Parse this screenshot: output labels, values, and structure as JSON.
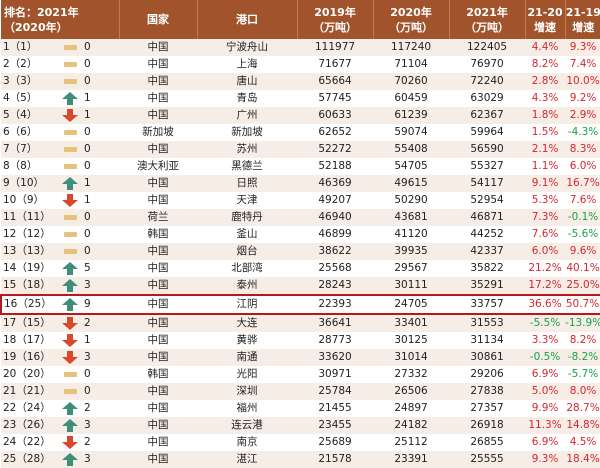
{
  "colors": {
    "header_bg": "#a1532c",
    "header_text": "#ffffff",
    "row_alt": "#f6ede6",
    "up_arrow": "#3e8e7a",
    "down_arrow": "#d9482b",
    "flat_bar": "#e7c27a",
    "positive_pct": "#d7262d",
    "negative_pct": "#16a24a",
    "highlight_border": "#b8171c"
  },
  "header": {
    "rank": "排名：2021年",
    "rank_sub": "（2020年）",
    "country": "国家",
    "port": "港口",
    "y2019": "2019年",
    "y2019_unit": "（万吨）",
    "y2020": "2020年",
    "y2020_unit": "（万吨）",
    "y2021": "2021年",
    "y2021_unit": "（万吨）",
    "g2120": "21-20",
    "g2120_sub": "增速",
    "g2119": "21-19",
    "g2119_sub": "增速"
  },
  "rows": [
    {
      "rank": "1（1）",
      "trend": "flat-bar-icon",
      "change": "0",
      "country": "中国",
      "port": "宁波舟山",
      "y2019": "111977",
      "y2020": "117240",
      "y2021": "122405",
      "g2120": "4.4%",
      "g2119": "9.3%"
    },
    {
      "rank": "2（2）",
      "trend": "flat-bar-icon",
      "change": "0",
      "country": "中国",
      "port": "上海",
      "y2019": "71677",
      "y2020": "71104",
      "y2021": "76970",
      "g2120": "8.2%",
      "g2119": "7.4%"
    },
    {
      "rank": "3（3）",
      "trend": "flat-bar-icon",
      "change": "0",
      "country": "中国",
      "port": "唐山",
      "y2019": "65664",
      "y2020": "70260",
      "y2021": "72240",
      "g2120": "2.8%",
      "g2119": "10.0%"
    },
    {
      "rank": "4（5）",
      "trend": "up-arrow-icon",
      "change": "1",
      "country": "中国",
      "port": "青岛",
      "y2019": "57745",
      "y2020": "60459",
      "y2021": "63029",
      "g2120": "4.3%",
      "g2119": "9.2%"
    },
    {
      "rank": "5（4）",
      "trend": "down-arrow-icon",
      "change": "1",
      "country": "中国",
      "port": "广州",
      "y2019": "60633",
      "y2020": "61239",
      "y2021": "62367",
      "g2120": "1.8%",
      "g2119": "2.9%"
    },
    {
      "rank": "6（6）",
      "trend": "flat-bar-icon",
      "change": "0",
      "country": "新加坡",
      "port": "新加坡",
      "y2019": "62652",
      "y2020": "59074",
      "y2021": "59964",
      "g2120": "1.5%",
      "g2119": "-4.3%"
    },
    {
      "rank": "7（7）",
      "trend": "flat-bar-icon",
      "change": "0",
      "country": "中国",
      "port": "苏州",
      "y2019": "52272",
      "y2020": "55408",
      "y2021": "56590",
      "g2120": "2.1%",
      "g2119": "8.3%"
    },
    {
      "rank": "8（8）",
      "trend": "flat-bar-icon",
      "change": "0",
      "country": "澳大利亚",
      "port": "黑德兰",
      "y2019": "52188",
      "y2020": "54705",
      "y2021": "55327",
      "g2120": "1.1%",
      "g2119": "6.0%"
    },
    {
      "rank": "9（10）",
      "trend": "up-arrow-icon",
      "change": "1",
      "country": "中国",
      "port": "日照",
      "y2019": "46369",
      "y2020": "49615",
      "y2021": "54117",
      "g2120": "9.1%",
      "g2119": "16.7%"
    },
    {
      "rank": "10（9）",
      "trend": "down-arrow-icon",
      "change": "1",
      "country": "中国",
      "port": "天津",
      "y2019": "49207",
      "y2020": "50290",
      "y2021": "52954",
      "g2120": "5.3%",
      "g2119": "7.6%"
    },
    {
      "rank": "11（11）",
      "trend": "flat-bar-icon",
      "change": "0",
      "country": "荷兰",
      "port": "鹿特丹",
      "y2019": "46940",
      "y2020": "43681",
      "y2021": "46871",
      "g2120": "7.3%",
      "g2119": "-0.1%"
    },
    {
      "rank": "12（12）",
      "trend": "flat-bar-icon",
      "change": "0",
      "country": "韩国",
      "port": "釜山",
      "y2019": "46899",
      "y2020": "41120",
      "y2021": "44252",
      "g2120": "7.6%",
      "g2119": "-5.6%"
    },
    {
      "rank": "13（13）",
      "trend": "flat-bar-icon",
      "change": "0",
      "country": "中国",
      "port": "烟台",
      "y2019": "38622",
      "y2020": "39935",
      "y2021": "42337",
      "g2120": "6.0%",
      "g2119": "9.6%"
    },
    {
      "rank": "14（19）",
      "trend": "up-arrow-icon",
      "change": "5",
      "country": "中国",
      "port": "北部湾",
      "y2019": "25568",
      "y2020": "29567",
      "y2021": "35822",
      "g2120": "21.2%",
      "g2119": "40.1%"
    },
    {
      "rank": "15（18）",
      "trend": "up-arrow-icon",
      "change": "3",
      "country": "中国",
      "port": "泰州",
      "y2019": "28243",
      "y2020": "30111",
      "y2021": "35291",
      "g2120": "17.2%",
      "g2119": "25.0%"
    },
    {
      "rank": "16（25）",
      "trend": "up-arrow-icon",
      "change": "9",
      "country": "中国",
      "port": "江阴",
      "y2019": "22393",
      "y2020": "24705",
      "y2021": "33757",
      "g2120": "36.6%",
      "g2119": "50.7%",
      "highlight": true
    },
    {
      "rank": "17（15）",
      "trend": "down-arrow-icon",
      "change": "2",
      "country": "中国",
      "port": "大连",
      "y2019": "36641",
      "y2020": "33401",
      "y2021": "31553",
      "g2120": "-5.5%",
      "g2119": "-13.9%"
    },
    {
      "rank": "18（17）",
      "trend": "down-arrow-icon",
      "change": "1",
      "country": "中国",
      "port": "黄骅",
      "y2019": "28773",
      "y2020": "30125",
      "y2021": "31134",
      "g2120": "3.3%",
      "g2119": "8.2%"
    },
    {
      "rank": "19（16）",
      "trend": "down-arrow-icon",
      "change": "3",
      "country": "中国",
      "port": "南通",
      "y2019": "33620",
      "y2020": "31014",
      "y2021": "30861",
      "g2120": "-0.5%",
      "g2119": "-8.2%"
    },
    {
      "rank": "20（20）",
      "trend": "flat-bar-icon",
      "change": "0",
      "country": "韩国",
      "port": "光阳",
      "y2019": "30971",
      "y2020": "27332",
      "y2021": "29206",
      "g2120": "6.9%",
      "g2119": "-5.7%"
    },
    {
      "rank": "21（21）",
      "trend": "flat-bar-icon",
      "change": "0",
      "country": "中国",
      "port": "深圳",
      "y2019": "25784",
      "y2020": "26506",
      "y2021": "27838",
      "g2120": "5.0%",
      "g2119": "8.0%"
    },
    {
      "rank": "22（24）",
      "trend": "up-arrow-icon",
      "change": "2",
      "country": "中国",
      "port": "福州",
      "y2019": "21455",
      "y2020": "24897",
      "y2021": "27357",
      "g2120": "9.9%",
      "g2119": "28.7%"
    },
    {
      "rank": "23（26）",
      "trend": "up-arrow-icon",
      "change": "3",
      "country": "中国",
      "port": "连云港",
      "y2019": "23455",
      "y2020": "24182",
      "y2021": "26918",
      "g2120": "11.3%",
      "g2119": "14.8%"
    },
    {
      "rank": "24（22）",
      "trend": "down-arrow-icon",
      "change": "2",
      "country": "中国",
      "port": "南京",
      "y2019": "25689",
      "y2020": "25112",
      "y2021": "26855",
      "g2120": "6.9%",
      "g2119": "4.5%"
    },
    {
      "rank": "25（28）",
      "trend": "up-arrow-icon",
      "change": "3",
      "country": "中国",
      "port": "湛江",
      "y2019": "21578",
      "y2020": "23391",
      "y2021": "25555",
      "g2120": "9.3%",
      "g2119": "18.4%"
    }
  ]
}
